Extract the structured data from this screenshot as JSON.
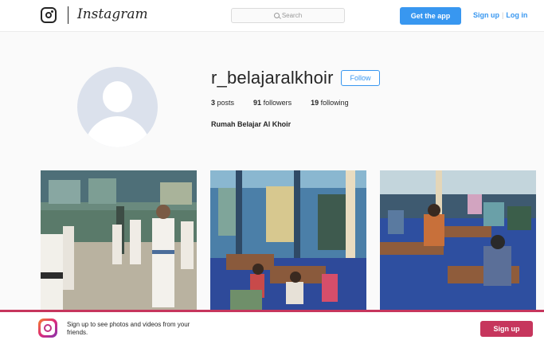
{
  "header": {
    "wordmark": "Instagram",
    "search_placeholder": "Search",
    "get_app_label": "Get the app",
    "signup_label": "Sign up",
    "separator": "|",
    "login_label": "Log in"
  },
  "profile": {
    "username": "r_belajaralkhoir",
    "follow_label": "Follow",
    "posts_count": "3",
    "posts_label": "posts",
    "followers_count": "91",
    "followers_label": "followers",
    "following_count": "19",
    "following_label": "following",
    "full_name": "Rumah Belajar Al Khoir"
  },
  "posts": [
    {
      "icon": "photo-karate-class"
    },
    {
      "icon": "photo-study-room"
    },
    {
      "icon": "photo-students-at-desks"
    }
  ],
  "banner": {
    "text": "Sign up to see photos and videos from your friends.",
    "signup_label": "Sign up"
  },
  "colors": {
    "accent": "#3897f0",
    "banner_accent": "#c6365d"
  }
}
